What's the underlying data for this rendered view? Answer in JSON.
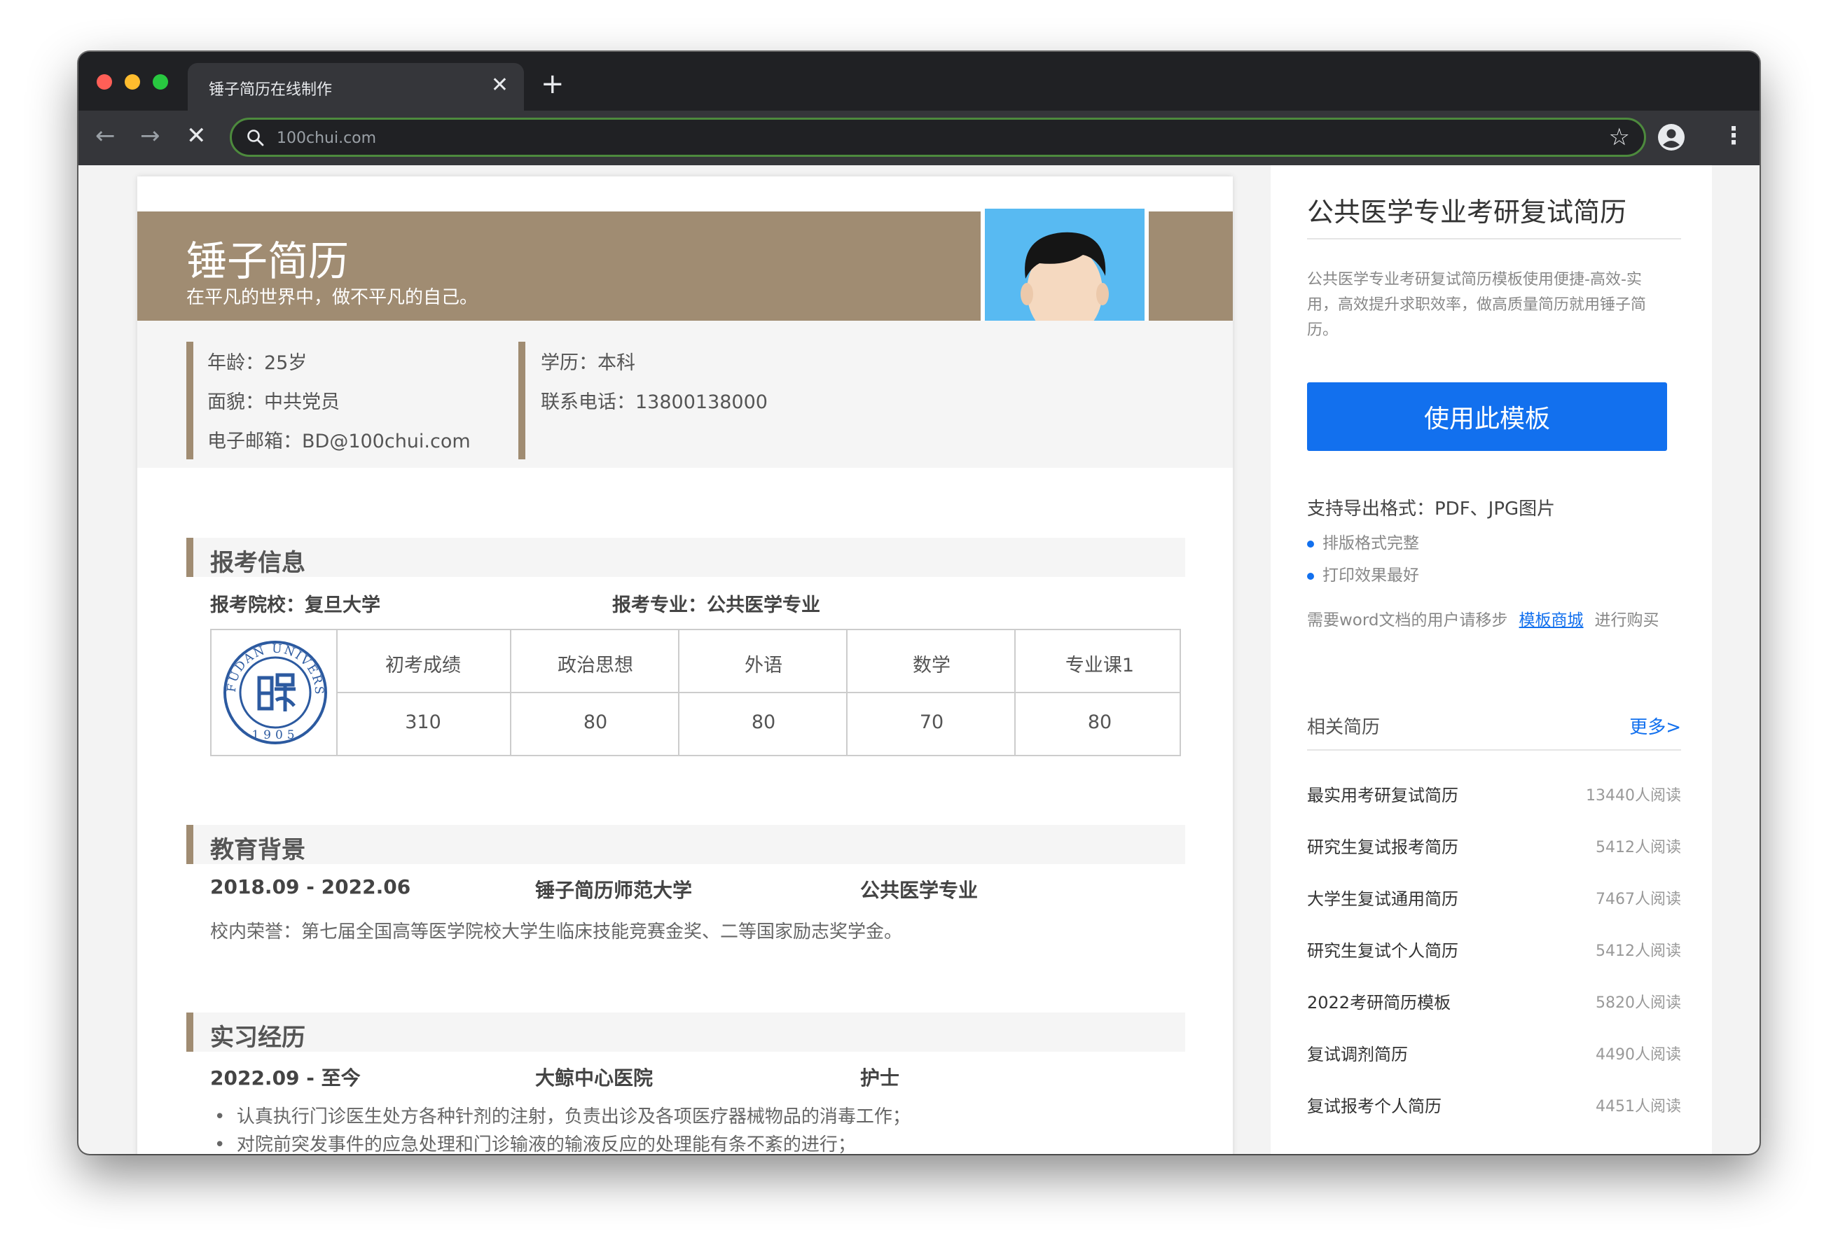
{
  "browser": {
    "tab_title": "锤子简历在线制作",
    "tab_close": "✕",
    "new_tab": "+",
    "url": "100chui.com",
    "back": "←",
    "forward": "→",
    "stop": "✕",
    "star": "☆",
    "menu": "⋮"
  },
  "resume": {
    "name": "锤子简历",
    "motto": "在平凡的世界中，做不平凡的自己。",
    "info_left": [
      "年龄：25岁",
      "面貌：中共党员",
      "电子邮箱：BD@100chui.com"
    ],
    "info_right": [
      "学历：本科",
      "联系电话：13800138000"
    ],
    "section_exam": {
      "title": "报考信息",
      "school": "报考院校：复旦大学",
      "major": "报考专业：公共医学专业",
      "headers": [
        "初考成绩",
        "政治思想",
        "外语",
        "数学",
        "专业课1"
      ],
      "scores": [
        "310",
        "80",
        "80",
        "70",
        "80"
      ],
      "logo_top": "FUDAN UNIVERSITY",
      "logo_year": "1905"
    },
    "section_edu": {
      "title": "教育背景",
      "period": "2018.09 - 2022.06",
      "school": "锤子简历师范大学",
      "major": "公共医学专业",
      "honor": "校内荣誉：第七届全国高等医学院校大学生临床技能竞赛金奖、二等国家励志奖学金。"
    },
    "section_intern": {
      "title": "实习经历",
      "period": "2022.09 - 至今",
      "org": "大鲸中心医院",
      "role": "护士",
      "bullets": [
        "认真执行门诊医生处方各种针剂的注射，负责出诊及各项医疗器械物品的消毒工作；",
        "对院前突发事件的应急处理和门诊输液的输液反应的处理能有条不紊的进行；"
      ]
    }
  },
  "sidebar": {
    "title": "公共医学专业考研复试简历",
    "desc": "公共医学专业考研复试简历模板使用便捷-高效-实用，高效提升求职效率，做高质量简历就用锤子简历。",
    "use_button": "使用此模板",
    "formats": "支持导出格式：PDF、JPG图片",
    "features": [
      "排版格式完整",
      "打印效果最好"
    ],
    "word_prefix": "需要word文档的用户请移步",
    "word_link": "模板商城",
    "word_suffix": "进行购买",
    "related_title": "相关简历",
    "related_more": "更多>",
    "related": [
      {
        "name": "最实用考研复试简历",
        "reads": "13440人阅读"
      },
      {
        "name": "研究生复试报考简历",
        "reads": "5412人阅读"
      },
      {
        "name": "大学生复试通用简历",
        "reads": "7467人阅读"
      },
      {
        "name": "研究生复试个人简历",
        "reads": "5412人阅读"
      },
      {
        "name": "2022考研简历模板",
        "reads": "5820人阅读"
      },
      {
        "name": "复试调剂简历",
        "reads": "4490人阅读"
      },
      {
        "name": "复试报考个人简历",
        "reads": "4451人阅读"
      }
    ]
  },
  "colors": {
    "accent": "#a08c72",
    "button_blue": "#1270ee",
    "traffic_red": "#ff5f57",
    "traffic_yellow": "#febc2e",
    "traffic_green": "#28c840"
  }
}
